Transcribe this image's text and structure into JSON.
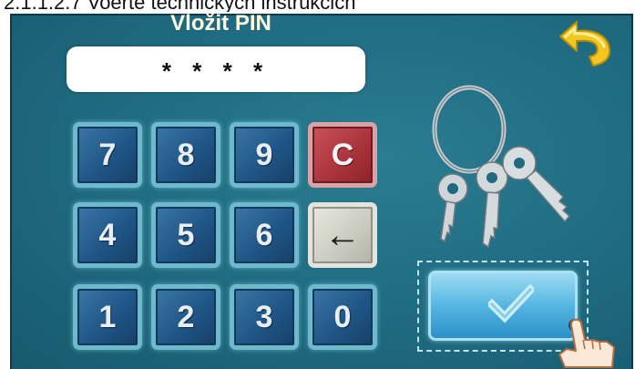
{
  "caption": "2.1.1.2.7 Voerte technickych instrukcich",
  "pin": {
    "title": "Vložit PIN",
    "masked_value": "* * * *"
  },
  "keypad": {
    "k7": "7",
    "k8": "8",
    "k9": "9",
    "clear": "C",
    "k4": "4",
    "k5": "5",
    "k6": "6",
    "backspace": "←",
    "k1": "1",
    "k2": "2",
    "k3": "3",
    "k0": "0"
  },
  "icons": {
    "back": "back-arrow-icon",
    "keys": "keys-icon",
    "confirm": "checkmark-icon",
    "hand": "pointing-hand-icon"
  },
  "colors": {
    "screen_bg": "#1f6a80",
    "title_text": "#fffbe0",
    "key_blue": "#1f5687",
    "key_clear": "#a8323a",
    "key_back": "#c9cbc0",
    "confirm_blue": "#55b6e2",
    "back_icon_yellow": "#f3c623"
  }
}
